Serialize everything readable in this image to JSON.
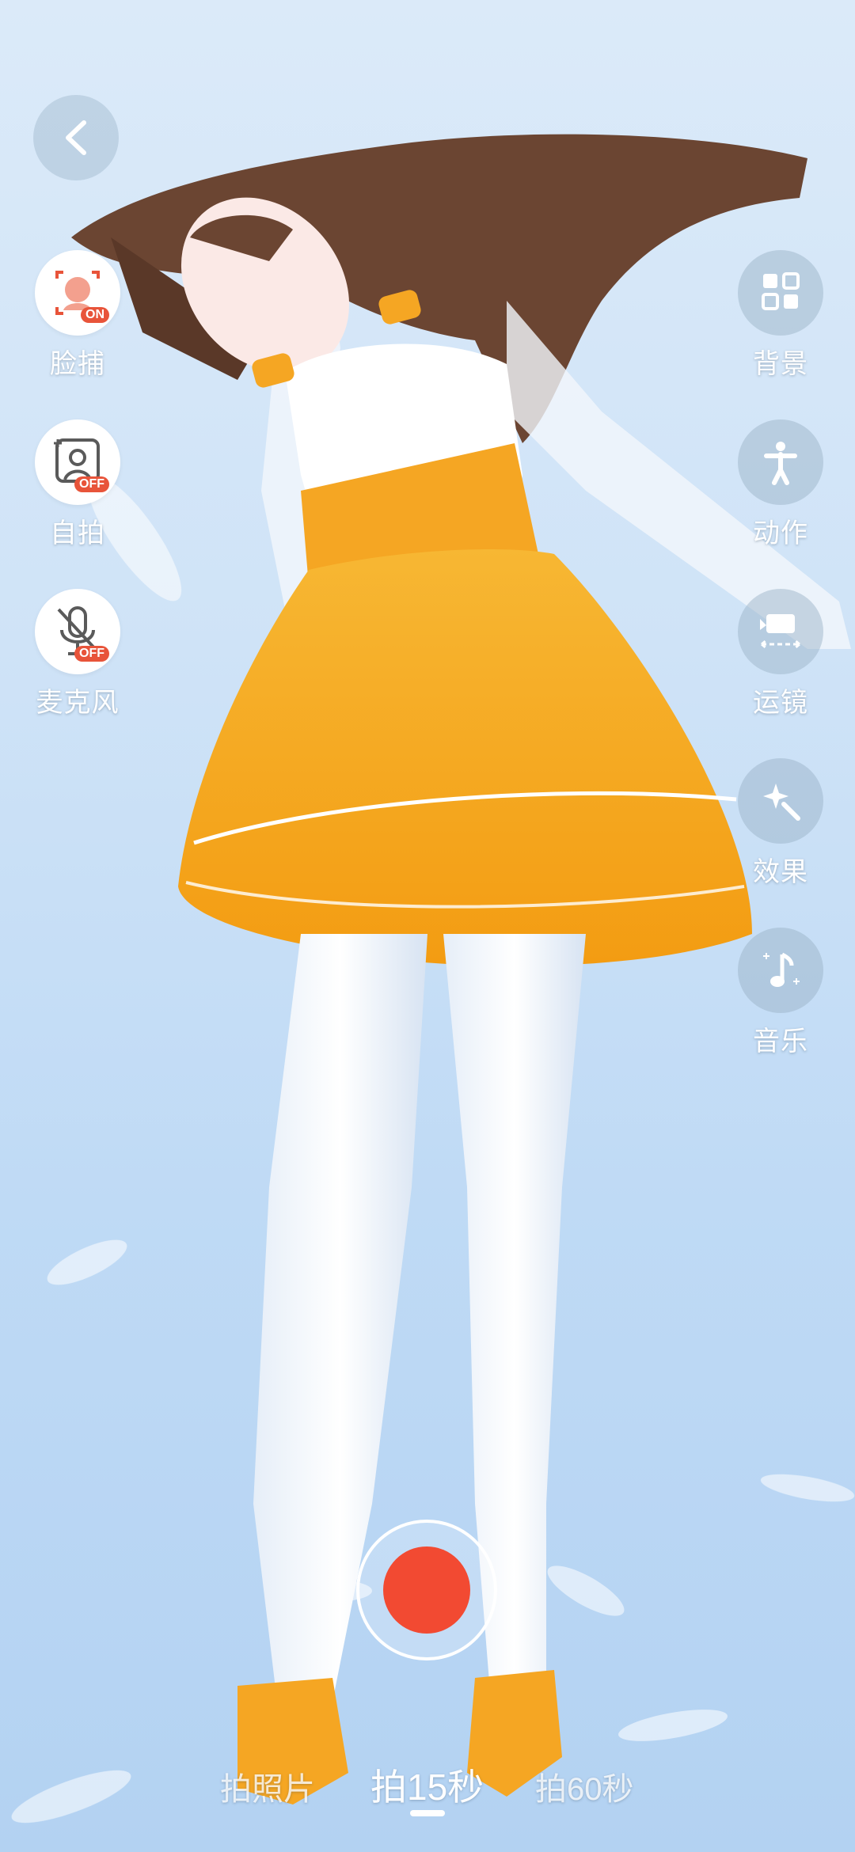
{
  "back": {
    "icon": "chevron-left-icon"
  },
  "left_controls": [
    {
      "id": "face-capture",
      "label": "脸捕",
      "status": "ON",
      "icon": "face-capture-icon"
    },
    {
      "id": "selfie",
      "label": "自拍",
      "status": "OFF",
      "icon": "selfie-portrait-icon"
    },
    {
      "id": "microphone",
      "label": "麦克风",
      "status": "OFF",
      "icon": "microphone-muted-icon"
    }
  ],
  "right_controls": [
    {
      "id": "background",
      "label": "背景",
      "icon": "background-grid-icon"
    },
    {
      "id": "action",
      "label": "动作",
      "icon": "person-pose-icon"
    },
    {
      "id": "camera-move",
      "label": "运镜",
      "icon": "camera-move-icon"
    },
    {
      "id": "effects",
      "label": "效果",
      "icon": "magic-wand-icon"
    },
    {
      "id": "music",
      "label": "音乐",
      "icon": "music-note-icon"
    }
  ],
  "capture_modes": {
    "photo": "拍照片",
    "video15": "拍15秒",
    "video60": "拍60秒",
    "selected": "拍15秒"
  },
  "colors": {
    "record": "#f24a32",
    "badge_on": "#e8543a",
    "dress": "#f5a623",
    "hair": "#6b4532"
  }
}
